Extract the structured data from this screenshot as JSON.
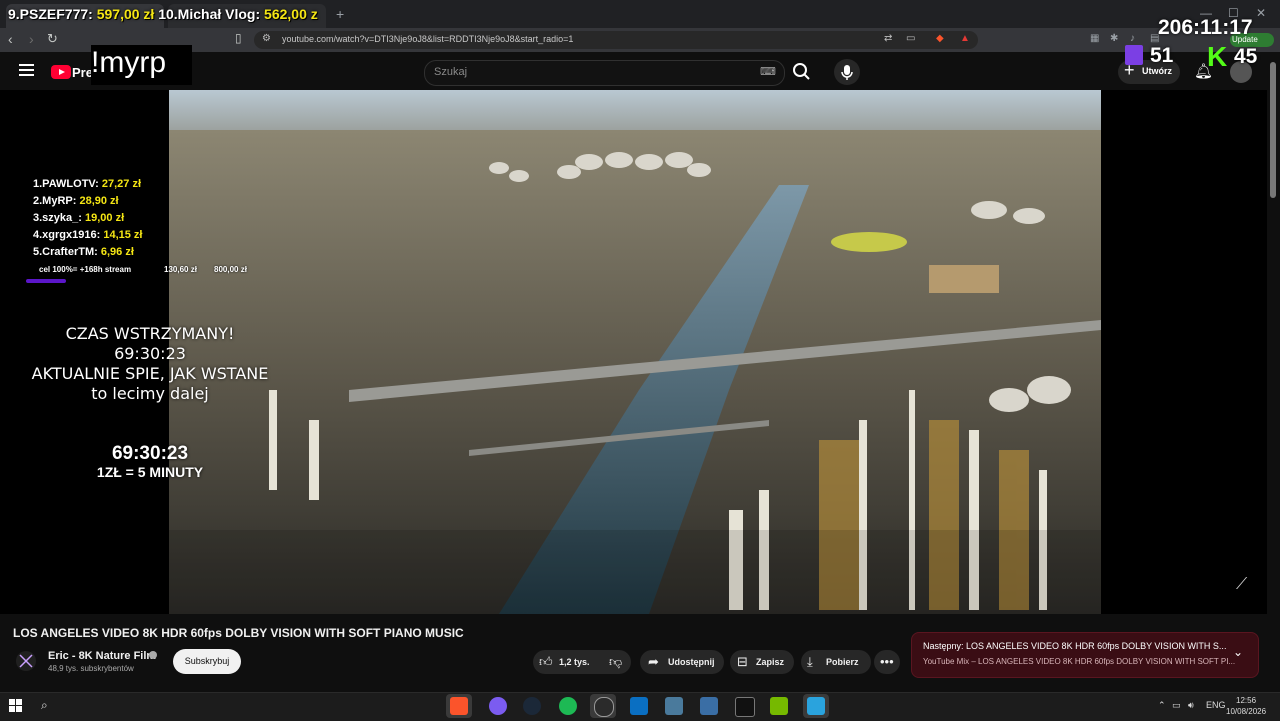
{
  "browser": {
    "url": "youtube.com/watch?v=DTI3Nje9oJ8&list=RDDTI3Nje9oJ8&start_radio=1",
    "new_tab_symbol": "+",
    "update_label": "Update"
  },
  "youtube": {
    "brand": "Pre",
    "search_placeholder": "Szukaj",
    "create_label": "Utwórz"
  },
  "overlay": {
    "top_ticker": {
      "item_a_name": "9.PSZEF777:",
      "item_a_amount": "597,00 zł",
      "item_b_name": "10.Michał Vlog:",
      "item_b_amount": "562,00 z"
    },
    "command": "!myrp",
    "stream_timer": "206:11:17",
    "twitch_viewers": "51",
    "kick_viewers": "45",
    "kick_letter": "K",
    "donors": [
      {
        "name": "1.PAWLOTV:",
        "amount": "27,27 zł"
      },
      {
        "name": "2.MyRP:",
        "amount": "28,90 zł"
      },
      {
        "name": "3.szyka_:",
        "amount": "19,00 zł"
      },
      {
        "name": "4.xgrgx1916:",
        "amount": "14,15 zł"
      },
      {
        "name": "5.CrafterTM:",
        "amount": "6,96 zł"
      }
    ],
    "goal": {
      "label": "cel 100%= +168h stream",
      "current": "130,60 zł",
      "target": "800,00 zł",
      "progress": 0.16
    },
    "paused_lines": [
      "CZAS WSTRZYMANY!",
      "69:30:23",
      "AKTUALNIE SPIE, JAK WSTANE",
      "to lecimy dalej"
    ],
    "countdown": "69:30:23",
    "rate": "1ZŁ = 5 MINUTY"
  },
  "video": {
    "title": "LOS ANGELES VIDEO 8K HDR 60fps DOLBY VISION WITH SOFT PIANO MUSIC",
    "channel_name": "Eric - 8K Nature Film",
    "subscribers": "48,9 tys. subskrybentów",
    "subscribe_label": "Subskrybuj",
    "likes": "1,2 tys.",
    "share_label": "Udostępnij",
    "save_label": "Zapisz",
    "download_label": "Pobierz"
  },
  "up_next": {
    "line1": "Następny: LOS ANGELES VIDEO 8K HDR 60fps DOLBY VISION WITH S...",
    "line2": "YouTube Mix – LOS ANGELES VIDEO 8K HDR 60fps DOLBY VISION WITH SOFT PI..."
  },
  "taskbar": {
    "language": "ENG",
    "time": "12:56",
    "date": "10/08/2026"
  },
  "colors": {
    "accent_yellow": "#f5e614",
    "youtube_red": "#ff0033",
    "twitch_purple": "#7b3fe4",
    "kick_green": "#53fc18",
    "up_next_bg": "#3a0d14"
  }
}
